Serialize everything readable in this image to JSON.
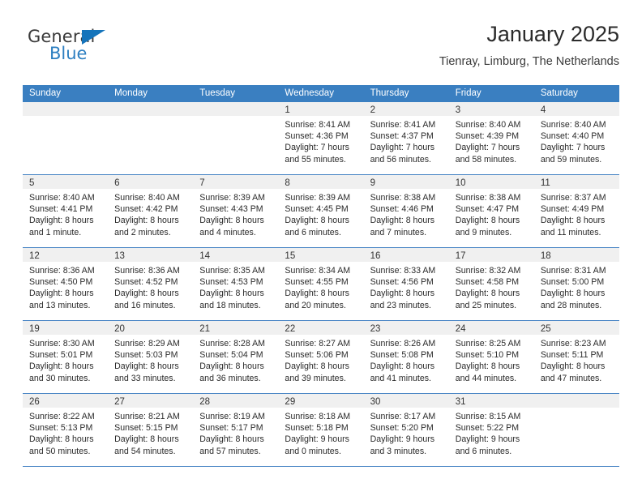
{
  "logo": {
    "word_one": "General",
    "word_two": "Blue",
    "triangle_icon": "triangle-icon",
    "accent_color": "#2d7fc1"
  },
  "header": {
    "title": "January 2025",
    "subtitle": "Tienray, Limburg, The Netherlands"
  },
  "calendar": {
    "header_bg": "#3a7fc1",
    "weekdays": [
      "Sunday",
      "Monday",
      "Tuesday",
      "Wednesday",
      "Thursday",
      "Friday",
      "Saturday"
    ],
    "weeks": [
      [
        {
          "day": "",
          "empty": true,
          "sunrise": "",
          "sunset": "",
          "daylight1": "",
          "daylight2": ""
        },
        {
          "day": "",
          "empty": true,
          "sunrise": "",
          "sunset": "",
          "daylight1": "",
          "daylight2": ""
        },
        {
          "day": "",
          "empty": true,
          "sunrise": "",
          "sunset": "",
          "daylight1": "",
          "daylight2": ""
        },
        {
          "day": "1",
          "empty": false,
          "sunrise": "Sunrise: 8:41 AM",
          "sunset": "Sunset: 4:36 PM",
          "daylight1": "Daylight: 7 hours",
          "daylight2": "and 55 minutes."
        },
        {
          "day": "2",
          "empty": false,
          "sunrise": "Sunrise: 8:41 AM",
          "sunset": "Sunset: 4:37 PM",
          "daylight1": "Daylight: 7 hours",
          "daylight2": "and 56 minutes."
        },
        {
          "day": "3",
          "empty": false,
          "sunrise": "Sunrise: 8:40 AM",
          "sunset": "Sunset: 4:39 PM",
          "daylight1": "Daylight: 7 hours",
          "daylight2": "and 58 minutes."
        },
        {
          "day": "4",
          "empty": false,
          "sunrise": "Sunrise: 8:40 AM",
          "sunset": "Sunset: 4:40 PM",
          "daylight1": "Daylight: 7 hours",
          "daylight2": "and 59 minutes."
        }
      ],
      [
        {
          "day": "5",
          "empty": false,
          "sunrise": "Sunrise: 8:40 AM",
          "sunset": "Sunset: 4:41 PM",
          "daylight1": "Daylight: 8 hours",
          "daylight2": "and 1 minute."
        },
        {
          "day": "6",
          "empty": false,
          "sunrise": "Sunrise: 8:40 AM",
          "sunset": "Sunset: 4:42 PM",
          "daylight1": "Daylight: 8 hours",
          "daylight2": "and 2 minutes."
        },
        {
          "day": "7",
          "empty": false,
          "sunrise": "Sunrise: 8:39 AM",
          "sunset": "Sunset: 4:43 PM",
          "daylight1": "Daylight: 8 hours",
          "daylight2": "and 4 minutes."
        },
        {
          "day": "8",
          "empty": false,
          "sunrise": "Sunrise: 8:39 AM",
          "sunset": "Sunset: 4:45 PM",
          "daylight1": "Daylight: 8 hours",
          "daylight2": "and 6 minutes."
        },
        {
          "day": "9",
          "empty": false,
          "sunrise": "Sunrise: 8:38 AM",
          "sunset": "Sunset: 4:46 PM",
          "daylight1": "Daylight: 8 hours",
          "daylight2": "and 7 minutes."
        },
        {
          "day": "10",
          "empty": false,
          "sunrise": "Sunrise: 8:38 AM",
          "sunset": "Sunset: 4:47 PM",
          "daylight1": "Daylight: 8 hours",
          "daylight2": "and 9 minutes."
        },
        {
          "day": "11",
          "empty": false,
          "sunrise": "Sunrise: 8:37 AM",
          "sunset": "Sunset: 4:49 PM",
          "daylight1": "Daylight: 8 hours",
          "daylight2": "and 11 minutes."
        }
      ],
      [
        {
          "day": "12",
          "empty": false,
          "sunrise": "Sunrise: 8:36 AM",
          "sunset": "Sunset: 4:50 PM",
          "daylight1": "Daylight: 8 hours",
          "daylight2": "and 13 minutes."
        },
        {
          "day": "13",
          "empty": false,
          "sunrise": "Sunrise: 8:36 AM",
          "sunset": "Sunset: 4:52 PM",
          "daylight1": "Daylight: 8 hours",
          "daylight2": "and 16 minutes."
        },
        {
          "day": "14",
          "empty": false,
          "sunrise": "Sunrise: 8:35 AM",
          "sunset": "Sunset: 4:53 PM",
          "daylight1": "Daylight: 8 hours",
          "daylight2": "and 18 minutes."
        },
        {
          "day": "15",
          "empty": false,
          "sunrise": "Sunrise: 8:34 AM",
          "sunset": "Sunset: 4:55 PM",
          "daylight1": "Daylight: 8 hours",
          "daylight2": "and 20 minutes."
        },
        {
          "day": "16",
          "empty": false,
          "sunrise": "Sunrise: 8:33 AM",
          "sunset": "Sunset: 4:56 PM",
          "daylight1": "Daylight: 8 hours",
          "daylight2": "and 23 minutes."
        },
        {
          "day": "17",
          "empty": false,
          "sunrise": "Sunrise: 8:32 AM",
          "sunset": "Sunset: 4:58 PM",
          "daylight1": "Daylight: 8 hours",
          "daylight2": "and 25 minutes."
        },
        {
          "day": "18",
          "empty": false,
          "sunrise": "Sunrise: 8:31 AM",
          "sunset": "Sunset: 5:00 PM",
          "daylight1": "Daylight: 8 hours",
          "daylight2": "and 28 minutes."
        }
      ],
      [
        {
          "day": "19",
          "empty": false,
          "sunrise": "Sunrise: 8:30 AM",
          "sunset": "Sunset: 5:01 PM",
          "daylight1": "Daylight: 8 hours",
          "daylight2": "and 30 minutes."
        },
        {
          "day": "20",
          "empty": false,
          "sunrise": "Sunrise: 8:29 AM",
          "sunset": "Sunset: 5:03 PM",
          "daylight1": "Daylight: 8 hours",
          "daylight2": "and 33 minutes."
        },
        {
          "day": "21",
          "empty": false,
          "sunrise": "Sunrise: 8:28 AM",
          "sunset": "Sunset: 5:04 PM",
          "daylight1": "Daylight: 8 hours",
          "daylight2": "and 36 minutes."
        },
        {
          "day": "22",
          "empty": false,
          "sunrise": "Sunrise: 8:27 AM",
          "sunset": "Sunset: 5:06 PM",
          "daylight1": "Daylight: 8 hours",
          "daylight2": "and 39 minutes."
        },
        {
          "day": "23",
          "empty": false,
          "sunrise": "Sunrise: 8:26 AM",
          "sunset": "Sunset: 5:08 PM",
          "daylight1": "Daylight: 8 hours",
          "daylight2": "and 41 minutes."
        },
        {
          "day": "24",
          "empty": false,
          "sunrise": "Sunrise: 8:25 AM",
          "sunset": "Sunset: 5:10 PM",
          "daylight1": "Daylight: 8 hours",
          "daylight2": "and 44 minutes."
        },
        {
          "day": "25",
          "empty": false,
          "sunrise": "Sunrise: 8:23 AM",
          "sunset": "Sunset: 5:11 PM",
          "daylight1": "Daylight: 8 hours",
          "daylight2": "and 47 minutes."
        }
      ],
      [
        {
          "day": "26",
          "empty": false,
          "sunrise": "Sunrise: 8:22 AM",
          "sunset": "Sunset: 5:13 PM",
          "daylight1": "Daylight: 8 hours",
          "daylight2": "and 50 minutes."
        },
        {
          "day": "27",
          "empty": false,
          "sunrise": "Sunrise: 8:21 AM",
          "sunset": "Sunset: 5:15 PM",
          "daylight1": "Daylight: 8 hours",
          "daylight2": "and 54 minutes."
        },
        {
          "day": "28",
          "empty": false,
          "sunrise": "Sunrise: 8:19 AM",
          "sunset": "Sunset: 5:17 PM",
          "daylight1": "Daylight: 8 hours",
          "daylight2": "and 57 minutes."
        },
        {
          "day": "29",
          "empty": false,
          "sunrise": "Sunrise: 8:18 AM",
          "sunset": "Sunset: 5:18 PM",
          "daylight1": "Daylight: 9 hours",
          "daylight2": "and 0 minutes."
        },
        {
          "day": "30",
          "empty": false,
          "sunrise": "Sunrise: 8:17 AM",
          "sunset": "Sunset: 5:20 PM",
          "daylight1": "Daylight: 9 hours",
          "daylight2": "and 3 minutes."
        },
        {
          "day": "31",
          "empty": false,
          "sunrise": "Sunrise: 8:15 AM",
          "sunset": "Sunset: 5:22 PM",
          "daylight1": "Daylight: 9 hours",
          "daylight2": "and 6 minutes."
        },
        {
          "day": "",
          "empty": true,
          "sunrise": "",
          "sunset": "",
          "daylight1": "",
          "daylight2": ""
        }
      ]
    ]
  }
}
